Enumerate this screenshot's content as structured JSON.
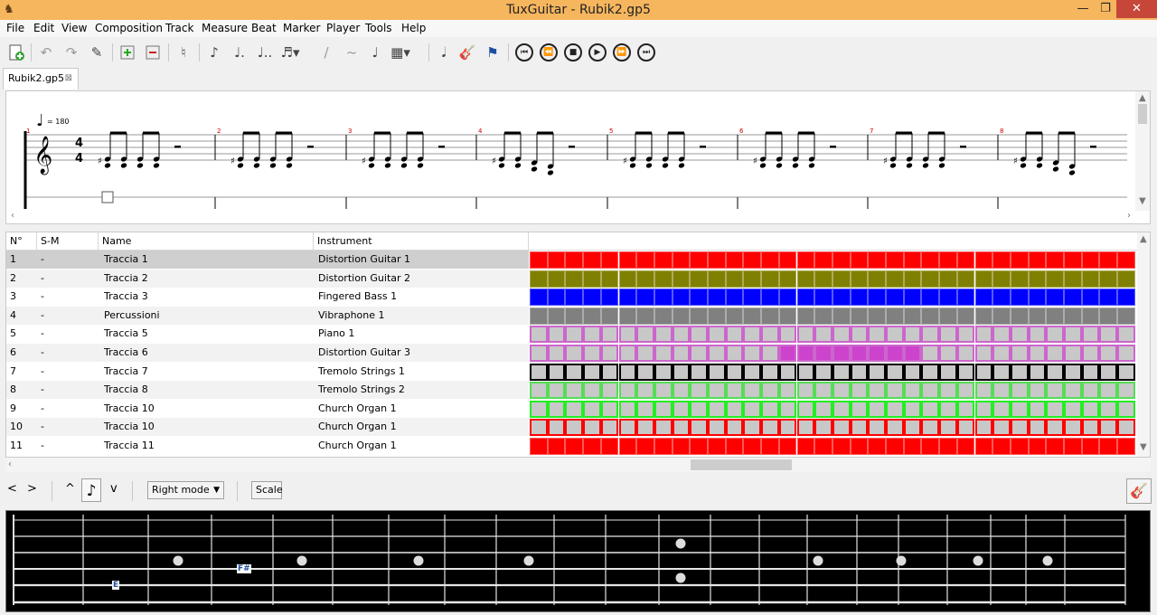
{
  "window": {
    "title": "TuxGuitar - Rubik2.gp5",
    "min": "—",
    "max": "❐",
    "close": "✕"
  },
  "menu": [
    "File",
    "Edit",
    "View",
    "Composition",
    "Track",
    "Measure",
    "Beat",
    "Marker",
    "Player",
    "Tools",
    "Help"
  ],
  "tab": {
    "label": "Rubik2.gp5",
    "close": "⊠"
  },
  "score": {
    "tempo": "= 180",
    "time_sig_top": "4",
    "time_sig_bottom": "4",
    "measure_numbers": [
      "1",
      "2",
      "3",
      "4",
      "5",
      "6",
      "7",
      "8"
    ]
  },
  "track_table": {
    "headers": [
      "N°",
      "S-M",
      "Name",
      "Instrument"
    ],
    "rows": [
      {
        "n": "1",
        "sm": "-",
        "name": "Traccia 1",
        "instrument": "Distortion Guitar 1",
        "color": "#ff0000",
        "border": "#ff0000",
        "style": "solid"
      },
      {
        "n": "2",
        "sm": "-",
        "name": "Traccia 2",
        "instrument": "Distortion Guitar 2",
        "color": "#808000",
        "border": "#808000",
        "style": "solid"
      },
      {
        "n": "3",
        "sm": "-",
        "name": "Traccia 3",
        "instrument": "Fingered Bass 1",
        "color": "#0000ff",
        "border": "#0000ff",
        "style": "solid"
      },
      {
        "n": "4",
        "sm": "-",
        "name": "Percussioni",
        "instrument": "Vibraphone 1",
        "color": "#808080",
        "border": "#808080",
        "style": "solid"
      },
      {
        "n": "5",
        "sm": "-",
        "name": "Traccia 5",
        "instrument": "Piano 1",
        "color": "#c8c8c8",
        "border": "#cc66cc",
        "style": "empty"
      },
      {
        "n": "6",
        "sm": "-",
        "name": "Traccia 6",
        "instrument": "Distortion Guitar 3",
        "color": "#c8c8c8",
        "border": "#cc66cc",
        "style": "partial",
        "fill": "#cc44cc"
      },
      {
        "n": "7",
        "sm": "-",
        "name": "Traccia 7",
        "instrument": "Tremolo Strings 1",
        "color": "#c8c8c8",
        "border": "#000000",
        "style": "empty"
      },
      {
        "n": "8",
        "sm": "-",
        "name": "Traccia 8",
        "instrument": "Tremolo Strings 2",
        "color": "#c8c8c8",
        "border": "#55dd55",
        "style": "empty"
      },
      {
        "n": "9",
        "sm": "-",
        "name": "Traccia 10",
        "instrument": "Church Organ 1",
        "color": "#c8c8c8",
        "border": "#22ee22",
        "style": "empty"
      },
      {
        "n": "10",
        "sm": "-",
        "name": "Traccia 10",
        "instrument": "Church Organ 1",
        "color": "#c8c8c8",
        "border": "#ff0000",
        "style": "empty"
      },
      {
        "n": "11",
        "sm": "-",
        "name": "Traccia 11",
        "instrument": "Church Organ 1",
        "color": "#ff0000",
        "border": "#ff0000",
        "style": "solid"
      }
    ]
  },
  "fret_controls": {
    "prev": "<",
    "next": ">",
    "up": "^",
    "down": "v",
    "mode": "Right mode",
    "scale": "Scale"
  },
  "fretboard": {
    "note_labels": [
      "E",
      "F#"
    ]
  },
  "icons": {
    "new": "new-file-icon",
    "undo": "undo-icon",
    "redo": "redo-icon",
    "edit": "pencil-icon",
    "play": "play-icon",
    "stop": "stop-icon",
    "rewind": "rewind-icon",
    "forward": "fast-forward-icon",
    "first": "skip-first-icon",
    "last": "skip-last-icon",
    "flag": "flag-icon",
    "guitar": "guitar-icon"
  }
}
